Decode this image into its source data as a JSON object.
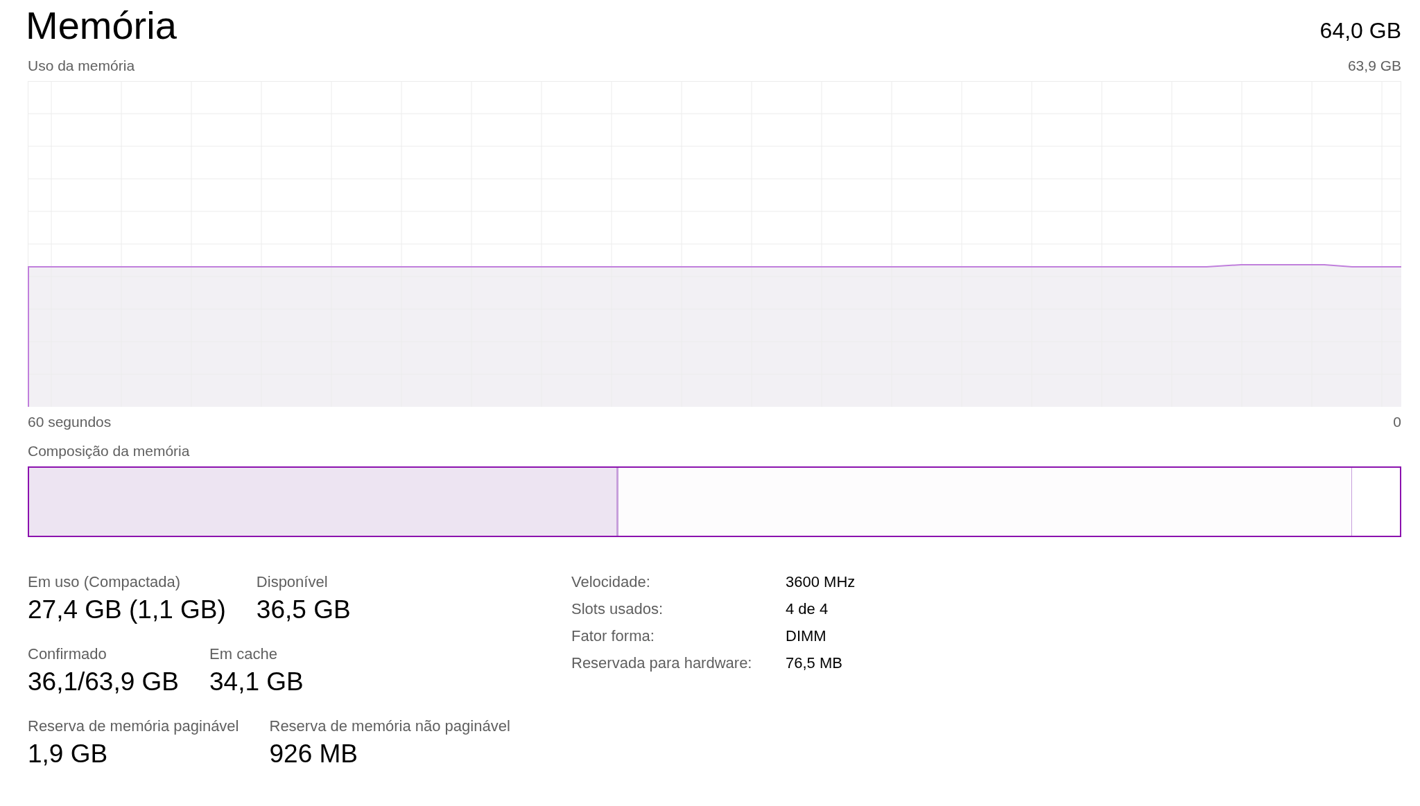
{
  "header": {
    "title": "Memória",
    "total": "64,0 GB"
  },
  "usage_graph": {
    "label": "Uso da memória",
    "max_label": "63,9 GB",
    "time_start": "60 segundos",
    "time_end": "0"
  },
  "composition": {
    "label": "Composição da memória",
    "segments": [
      {
        "kind": "in_use",
        "level": 0.43
      },
      {
        "kind": "standby",
        "level": 0.965
      }
    ]
  },
  "stats": [
    [
      {
        "label": "Em uso (Compactada)",
        "value": "27,4 GB (1,1 GB)"
      },
      {
        "label": "Disponível",
        "value": "36,5 GB"
      }
    ],
    [
      {
        "label": "Confirmado",
        "value": "36,1/63,9 GB"
      },
      {
        "label": "Em cache",
        "value": "34,1 GB"
      }
    ],
    [
      {
        "label": "Reserva de memória paginável",
        "value": "1,9 GB"
      },
      {
        "label": "Reserva de memória não paginável",
        "value": "926 MB"
      }
    ]
  ],
  "details": [
    {
      "label": "Velocidade:",
      "value": "3600 MHz"
    },
    {
      "label": "Slots usados:",
      "value": "4 de 4"
    },
    {
      "label": "Fator forma:",
      "value": "DIMM"
    },
    {
      "label": "Reservada para hardware:",
      "value": "76,5 MB"
    }
  ]
}
